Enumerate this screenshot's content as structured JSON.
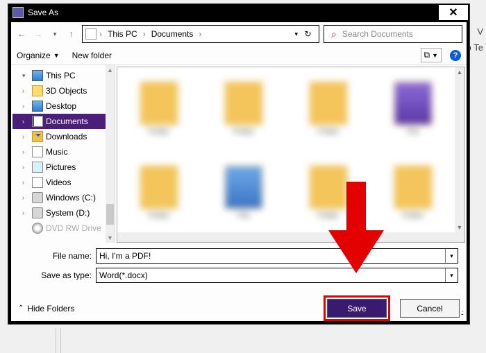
{
  "window": {
    "title": "Save As"
  },
  "nav": {
    "crumbs": [
      "This PC",
      "Documents"
    ],
    "search_placeholder": "Search Documents"
  },
  "toolbar": {
    "organize": "Organize",
    "new_folder": "New folder"
  },
  "tree": {
    "root": "This PC",
    "items": [
      {
        "label": "3D Objects",
        "iconClass": "icon-folder alt"
      },
      {
        "label": "Desktop",
        "iconClass": "icon-pc"
      },
      {
        "label": "Documents",
        "iconClass": "icon-doc",
        "selected": true
      },
      {
        "label": "Downloads",
        "iconClass": "icon-down"
      },
      {
        "label": "Music",
        "iconClass": "icon-music"
      },
      {
        "label": "Pictures",
        "iconClass": "icon-pic"
      },
      {
        "label": "Videos",
        "iconClass": "icon-vid"
      },
      {
        "label": "Windows (C:)",
        "iconClass": "icon-drive"
      },
      {
        "label": "System (D:)",
        "iconClass": "icon-drive"
      },
      {
        "label": "DVD RW Drive",
        "iconClass": "icon-dvd"
      }
    ]
  },
  "fields": {
    "file_name_label": "File name:",
    "file_name_value": "Hi, I'm a PDF!",
    "save_type_label": "Save as type:",
    "save_type_value": "Word(*.docx)"
  },
  "footer": {
    "hide_folders": "Hide Folders",
    "save": "Save",
    "cancel": "Cancel"
  },
  "background": {
    "line1": "V",
    "line2": "To Te"
  }
}
